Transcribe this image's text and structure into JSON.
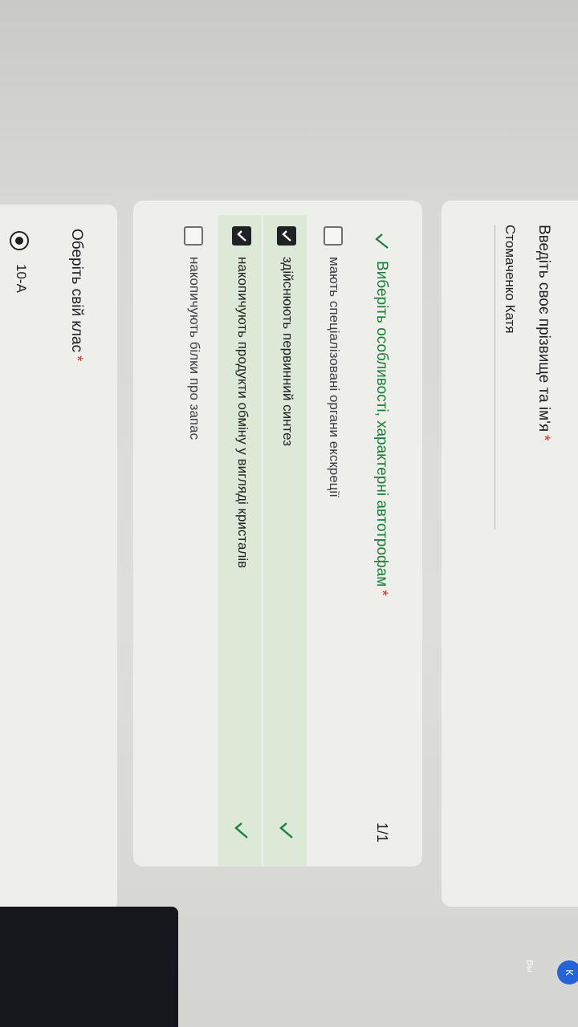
{
  "name_question": {
    "title": "Введіть своє прізвище та ім'я",
    "required_mark": "*",
    "answer": "Стомаченко Катя"
  },
  "autotroph_question": {
    "title": "Виберіть особливості, характерні автотрофам",
    "required_mark": "*",
    "score": "1/1",
    "options": [
      {
        "label": "мають спеціалізовані органи екскреції",
        "checked": false,
        "correct": false
      },
      {
        "label": "здійснюють первинний синтез",
        "checked": true,
        "correct": true
      },
      {
        "label": "накопичують продукти обміну у вигляді кристалів",
        "checked": true,
        "correct": true
      },
      {
        "label": "накопичують білки про запас",
        "checked": false,
        "correct": false
      }
    ]
  },
  "class_question": {
    "title": "Оберіть свій клас",
    "required_mark": "*",
    "selected_option": "10-А"
  },
  "account": {
    "avatar_letter": "К",
    "label": "Вы"
  },
  "colors": {
    "correct_green": "#188038",
    "correct_bg": "#dce9d6",
    "required_red": "#d93025",
    "avatar_blue": "#2563d8"
  }
}
